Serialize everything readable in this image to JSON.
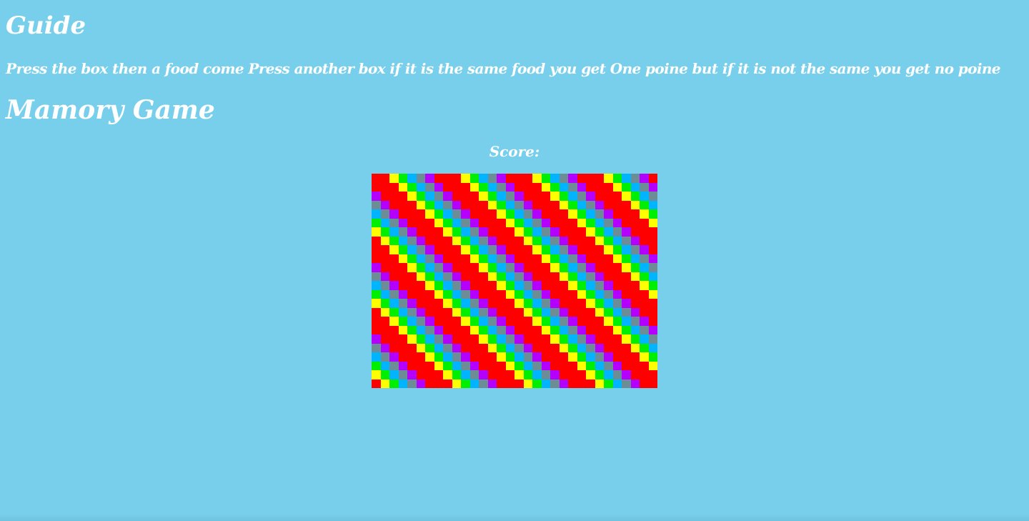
{
  "guide": {
    "title": "Guide",
    "text": "Press the box then a food come Press another box if it is the same food you get One poine but if it is not the same you get no poine"
  },
  "game": {
    "title": "Mamory Game",
    "score_label": "Score:"
  },
  "board": {
    "columns": 32,
    "rows": 24,
    "palette": [
      "#ff0000",
      "#ff0000",
      "#ffff00",
      "#00ee00",
      "#00b4ff",
      "#6c8c96",
      "#b400ff",
      "#ff0000"
    ]
  },
  "colors": {
    "background": "#78cfec",
    "text": "#ffffff"
  }
}
